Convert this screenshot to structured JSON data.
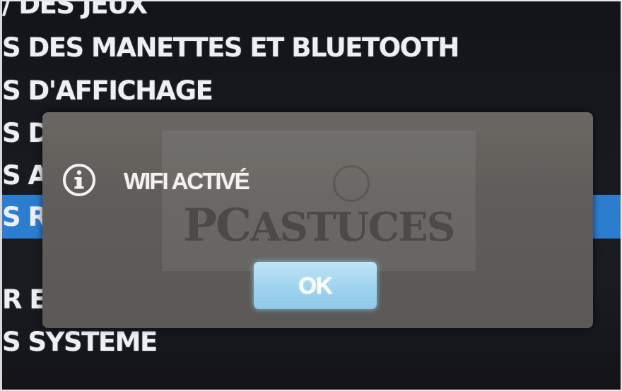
{
  "settings_menu": {
    "items": [
      "DES JEUX",
      "DES MANETTES ET BLUETOOTH",
      "D'AFFICHAGE",
      "D",
      "A",
      "R",
      "E",
      "SYSTEME"
    ],
    "selected_index": 5,
    "highlight_color": "#2b7dd0"
  },
  "dialog": {
    "icon": "info-icon",
    "title": "WIFI ACTIVÉ",
    "ok_label": "OK",
    "ok_color": "#a8d8f2"
  },
  "watermark": {
    "text_prefix": "PC",
    "text_suffix": "ASTUCES"
  }
}
